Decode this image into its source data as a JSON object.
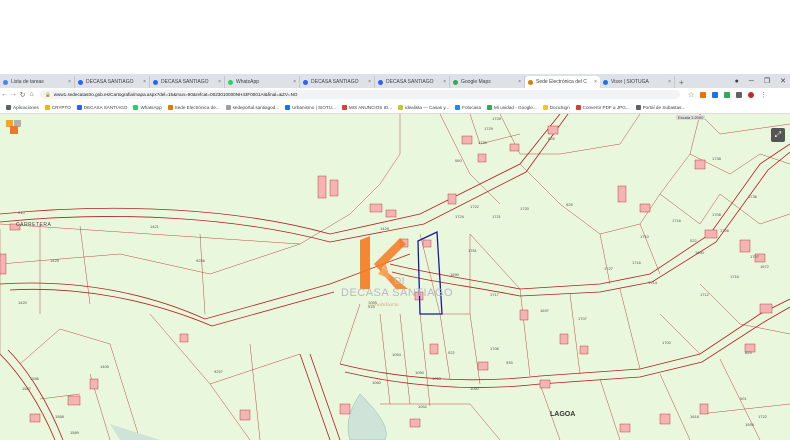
{
  "browser": {
    "tabs": [
      {
        "label": "Lista de tareas",
        "color": "#4285f4"
      },
      {
        "label": "DECASA SANTIAGO",
        "color": "#2962ff"
      },
      {
        "label": "DECASA SANTIAGO",
        "color": "#2962ff"
      },
      {
        "label": "WhatsApp",
        "color": "#25d366"
      },
      {
        "label": "DECASA SANTIAGO",
        "color": "#2962ff"
      },
      {
        "label": "DECASA SANTIAGO",
        "color": "#2962ff"
      },
      {
        "label": "Google Maps",
        "color": "#34a853"
      },
      {
        "label": "Sede Electrónica del C",
        "color": "#e07b00",
        "active": true
      },
      {
        "label": "Visor | SIOTUGA",
        "color": "#1a73e8"
      }
    ],
    "new_tab": "+",
    "url": "www1.sedecatastro.gob.es/Cartografia/mapa.aspx?del=15&mun=90&refcat=0023010000NH43F0001AI&final=&ZV=NO",
    "bookmarks": [
      {
        "label": "Aplicaciones",
        "color": "#5f6368"
      },
      {
        "label": "CRYPTO",
        "color": "#f4b400"
      },
      {
        "label": "DECASA SANTIAGO",
        "color": "#2962ff"
      },
      {
        "label": "WhatsApp",
        "color": "#25d366"
      },
      {
        "label": "Sede Electrónica de...",
        "color": "#e07b00"
      },
      {
        "label": "sedeportal.santiagod...",
        "color": "#9e9e9e"
      },
      {
        "label": "Urbanismo | SIOTU...",
        "color": "#1a73e8"
      },
      {
        "label": "MIS ANUNCIOS ID...",
        "color": "#e53935"
      },
      {
        "label": "idealista — Casas y...",
        "color": "#c0ca33"
      },
      {
        "label": "Fotocasa",
        "color": "#1e88e5"
      },
      {
        "label": "Mi unidad - Google...",
        "color": "#34a853"
      },
      {
        "label": "DocuSign",
        "color": "#fbc02d"
      },
      {
        "label": "Convertir PDF a JPG...",
        "color": "#e53935"
      },
      {
        "label": "Portal de Subastas...",
        "color": "#5f6368"
      }
    ]
  },
  "map": {
    "scale_label": "Escala 1:2000",
    "street_carretera": "CARRETERA",
    "street_lagoa": "LAGOA",
    "parcel_numbers": [
      "010",
      "9256",
      "1423",
      "1420",
      "1586",
      "1587",
      "1588",
      "1589",
      "9257",
      "1405",
      "1421",
      "1429",
      "1730",
      "1729",
      "1728",
      "1722",
      "1721",
      "1724",
      "1720",
      "626",
      "060",
      "1738",
      "1736",
      "1757",
      "1712",
      "1716",
      "1708",
      "1706",
      "1716",
      "1710",
      "1714",
      "1727",
      "1716",
      "1781",
      "1690",
      "1717",
      "915",
      "1060",
      "1054",
      "1050",
      "1053",
      "1052",
      "1050",
      "1055",
      "022",
      "1697",
      "1707",
      "1706",
      "935",
      "1700",
      "825",
      "926",
      "022",
      "001",
      "1722",
      "1595",
      "1590",
      "1618",
      "1672",
      "1739",
      "1713"
    ],
    "watermark_main": "DECASA SANTIAGO",
    "watermark_sub": "Inmobiliaria",
    "watermark_di": "DI"
  },
  "colors": {
    "map_bg": "#e9f7dc",
    "parcel_line": "#b02020",
    "building": "#f4b4b4",
    "selected_outline": "#1a1aa0",
    "watermark_orange": "#f47a20"
  }
}
